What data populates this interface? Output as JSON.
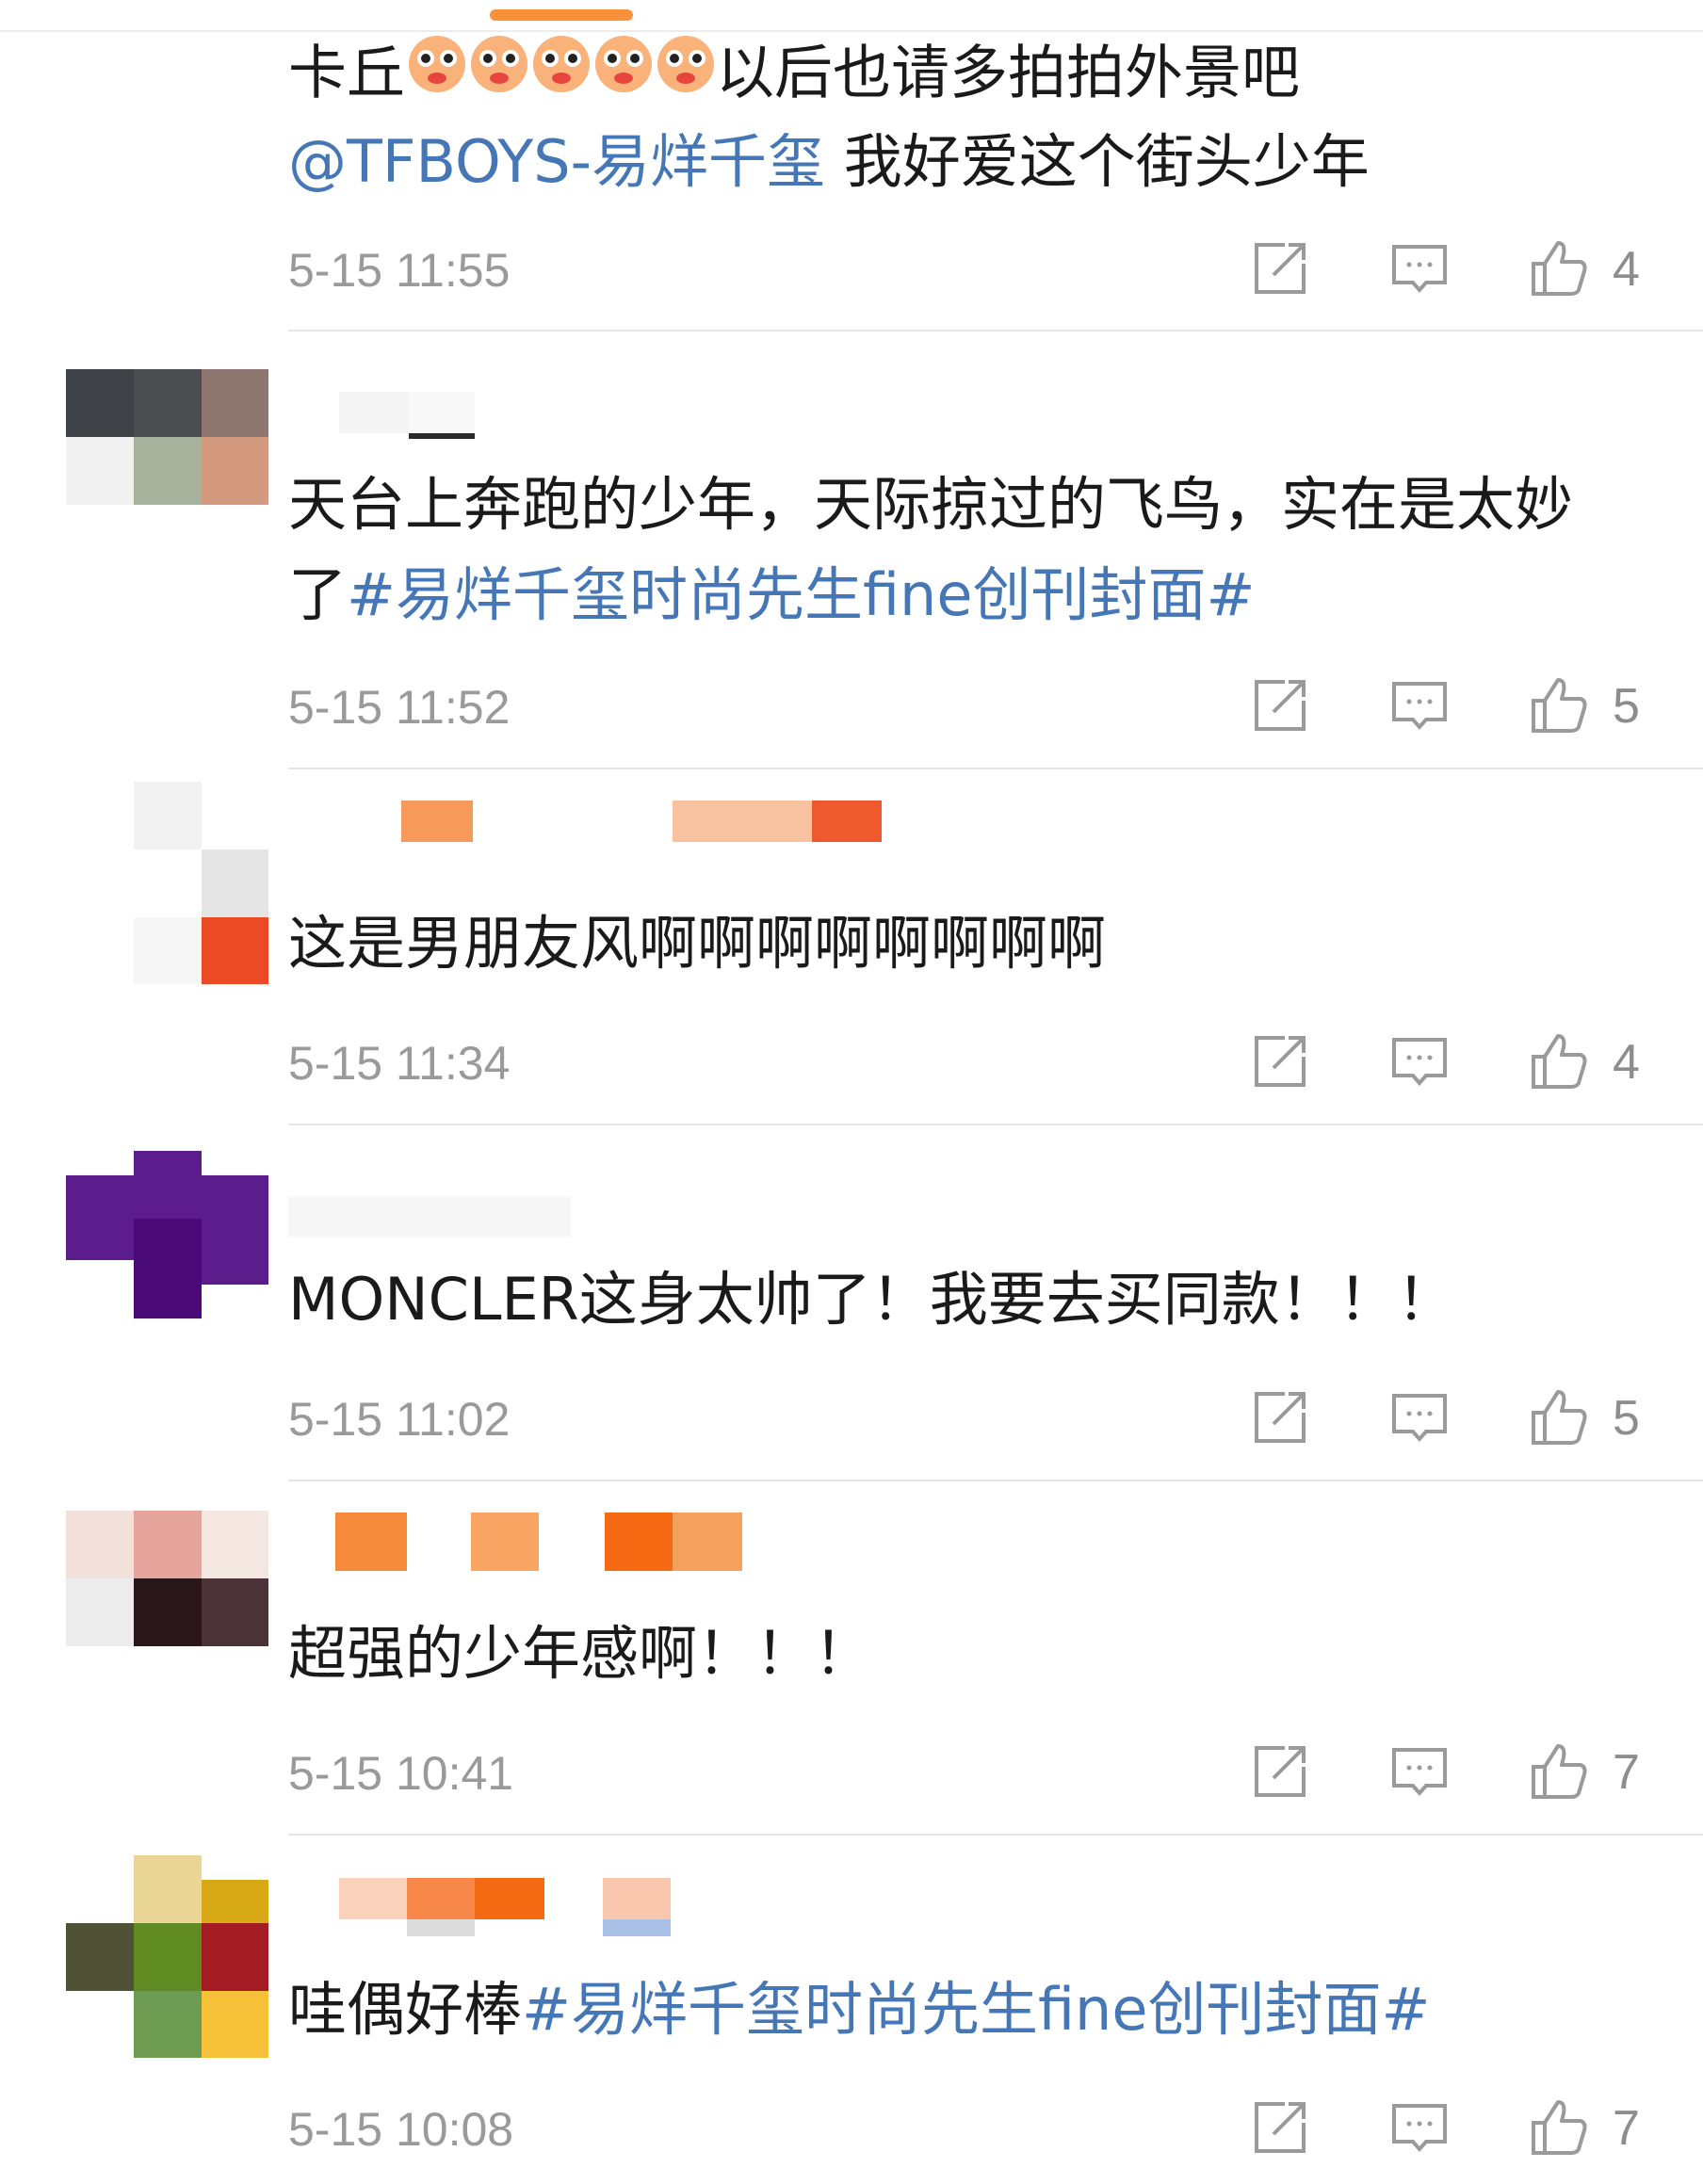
{
  "comments": [
    {
      "line1": "卡丘",
      "line1_tail": "以后也请多拍拍外景吧",
      "line2_link": "@TFBOYS-易烊千玺",
      "line2_text": " 我好爱这个街头少年",
      "time": "5-15 11:55",
      "likes": "4"
    },
    {
      "line1": "天台上奔跑的少年，天际掠过的飞鸟，实在是太妙",
      "line2_text": "了",
      "line2_link": "#易烊千玺时尚先生fine创刊封面#",
      "time": "5-15 11:52",
      "likes": "5"
    },
    {
      "line1": "这是男朋友风啊啊啊啊啊啊啊啊",
      "time": "5-15 11:34",
      "likes": "4"
    },
    {
      "line1": "MONCLER这身太帅了！我要去买同款！！！",
      "time": "5-15 11:02",
      "likes": "5"
    },
    {
      "line1": "超强的少年感啊！！！",
      "time": "5-15 10:41",
      "likes": "7"
    },
    {
      "line1_text": "哇偶好棒",
      "line1_link": "#易烊千玺时尚先生fine创刊封面#",
      "time": "5-15 10:08",
      "likes": "7"
    }
  ],
  "icons": {
    "repost": "repost-icon",
    "comment": "comment-icon",
    "like": "thumbs-up-icon",
    "emoji": "hamster-emoji-icon"
  },
  "colors": {
    "link": "#4577b6",
    "text": "#1a1a1a",
    "meta": "#9a9a9a",
    "accent": "#f7913a"
  }
}
